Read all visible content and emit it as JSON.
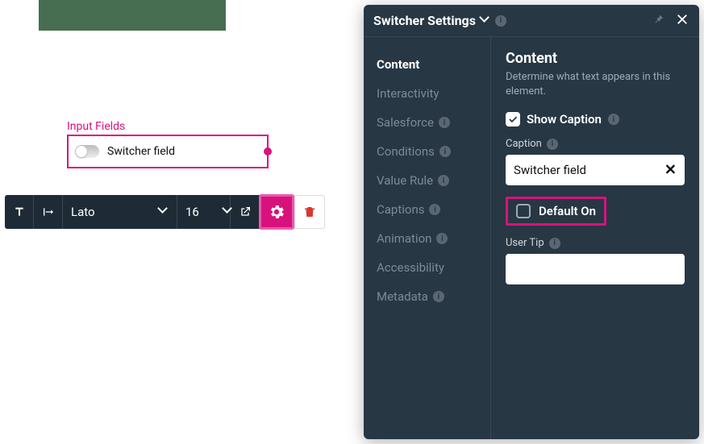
{
  "canvas": {
    "group_label": "Input Fields",
    "switcher_caption": "Switcher field"
  },
  "toolbar": {
    "font": "Lato",
    "size": "16"
  },
  "panel": {
    "title": "Switcher Settings",
    "nav": [
      {
        "label": "Content",
        "info": false
      },
      {
        "label": "Interactivity",
        "info": false
      },
      {
        "label": "Salesforce",
        "info": true
      },
      {
        "label": "Conditions",
        "info": true
      },
      {
        "label": "Value Rule",
        "info": true
      },
      {
        "label": "Captions",
        "info": true
      },
      {
        "label": "Animation",
        "info": true
      },
      {
        "label": "Accessibility",
        "info": false
      },
      {
        "label": "Metadata",
        "info": true
      }
    ],
    "content": {
      "heading": "Content",
      "description": "Determine what text appears in this element.",
      "show_caption_label": "Show Caption",
      "caption_label": "Caption",
      "caption_value": "Switcher field",
      "default_on_label": "Default On",
      "user_tip_label": "User Tip",
      "user_tip_value": ""
    }
  }
}
